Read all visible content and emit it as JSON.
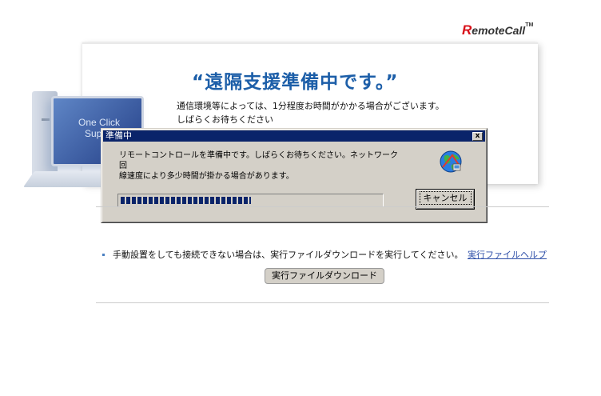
{
  "logo": {
    "r_mark": "R",
    "name": "emoteCall",
    "tm": "TM"
  },
  "card": {
    "headline": "“遠隔支援準備中です。”",
    "desc_line1": "通信環境等によっては、1分程度お時間がかかる場合がございます。",
    "desc_line2": "しばらくお待ちください",
    "illustration_text_line1": "One Click",
    "illustration_text_line2": "Sup"
  },
  "dialog": {
    "title": "準備中",
    "close_label": "x",
    "message_line1": "リモートコントロールを準備中です。しばらくお待ちください。ネットワーク回",
    "message_line2": "線速度により多少時間が掛かる場合があります。",
    "progress_fraction": 0.5,
    "cancel_label": "キャンセル",
    "icon": "globe-network-icon"
  },
  "lower": {
    "note": "手動設置をしても接続できない場合は、実行ファイルダウンロードを実行してください。",
    "help_link": "実行ファイルヘルプ",
    "download_button": "実行ファイルダウンロード"
  },
  "colors": {
    "headline": "#1c5ea8",
    "titlebar": "#0a246a",
    "logo_red": "#d8121b",
    "link": "#2e4fa8"
  }
}
